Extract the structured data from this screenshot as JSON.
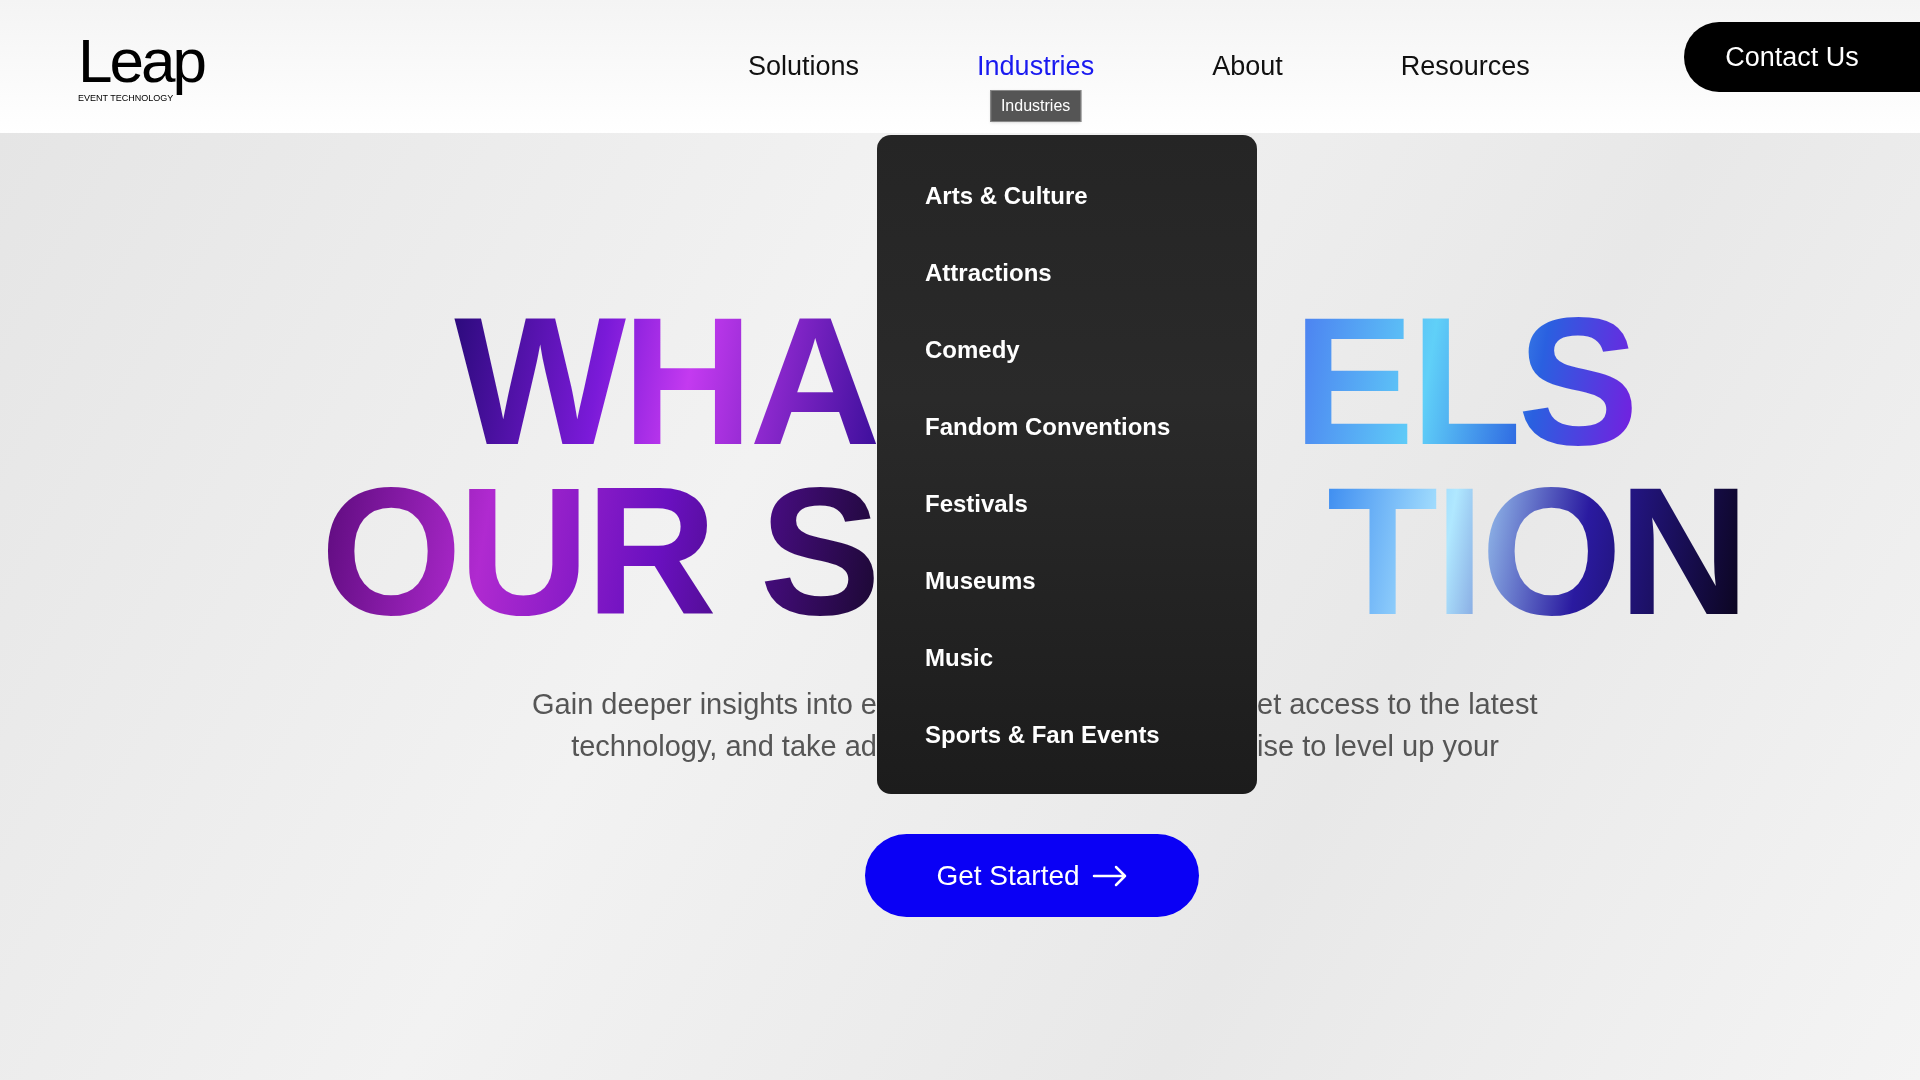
{
  "header": {
    "logo": {
      "wordmark": "Leap",
      "tagline": "EVENT TECHNOLOGY"
    },
    "nav": [
      {
        "label": "Solutions",
        "selected": false
      },
      {
        "label": "Industries",
        "selected": true,
        "tooltip": "Industries"
      },
      {
        "label": "About",
        "selected": false
      },
      {
        "label": "Resources",
        "selected": false
      }
    ],
    "contact_button": "Contact Us"
  },
  "industries_menu": {
    "items": [
      "Arts & Culture",
      "Attractions",
      "Comedy",
      "Fandom Conventions",
      "Festivals",
      "Museums",
      "Music",
      "Sports & Fan Events"
    ]
  },
  "hero": {
    "headline_rows": [
      {
        "left": "WHA",
        "right": "ELS"
      },
      {
        "left": "OUR S",
        "right": "TION"
      }
    ],
    "text_rows": [
      {
        "left": "Gain deeper insights into e",
        "right": "et access to the latest"
      },
      {
        "left": "technology, and take ad",
        "right": "ise to level up your"
      }
    ],
    "cta": "Get Started"
  }
}
